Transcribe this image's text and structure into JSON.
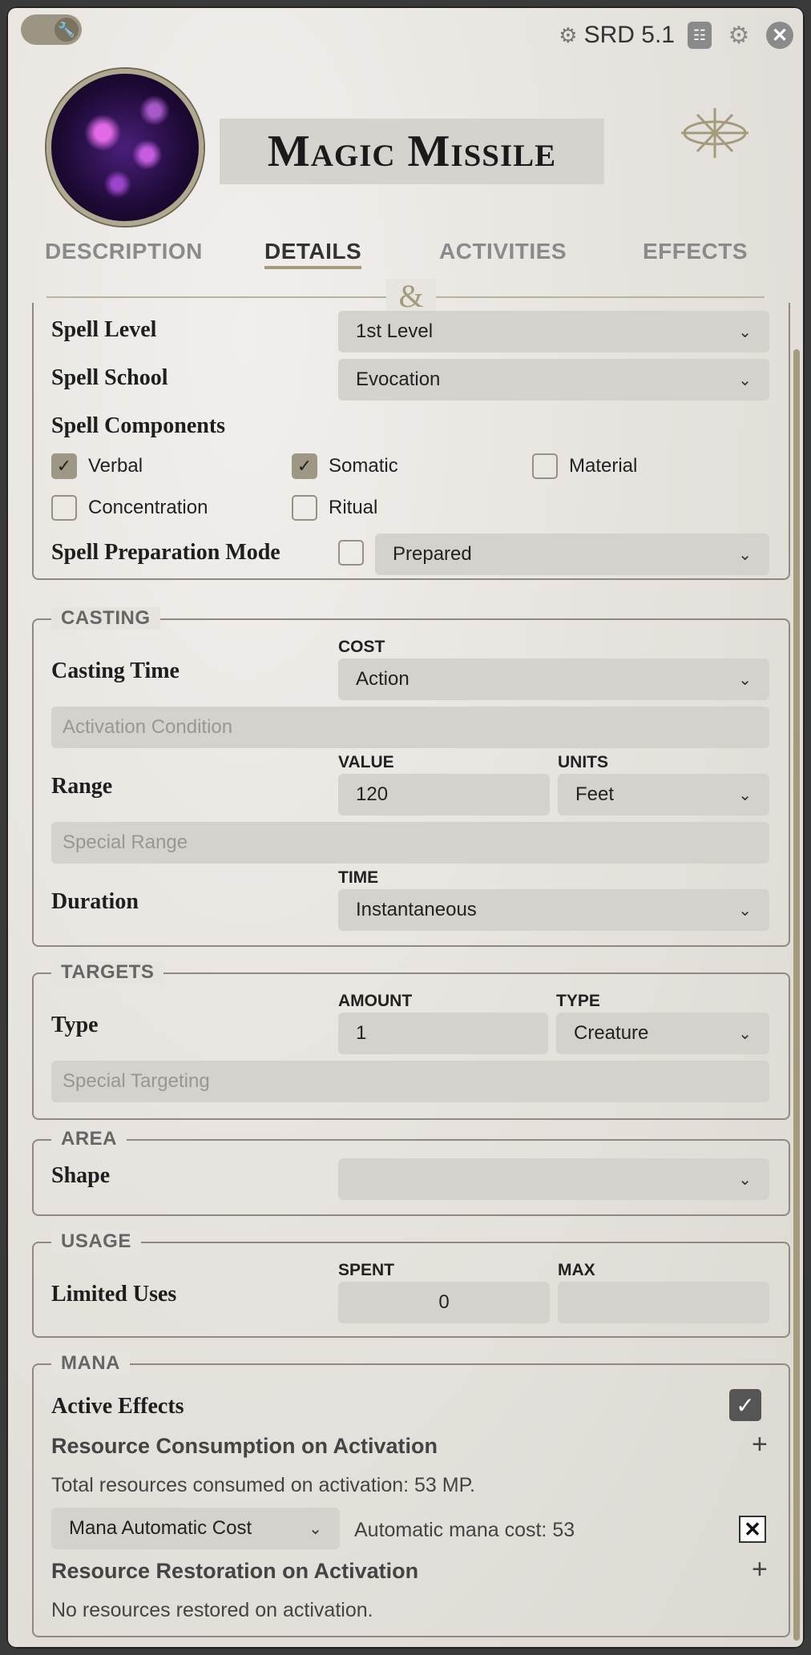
{
  "header": {
    "system_label": "SRD 5.1",
    "title": "Magic Missile",
    "icons": [
      "wrench-icon",
      "gear-icon",
      "journal-icon",
      "settings-icon",
      "close-icon",
      "emblem-icon"
    ]
  },
  "tabs": [
    {
      "label": "DESCRIPTION"
    },
    {
      "label": "DETAILS"
    },
    {
      "label": "ACTIVITIES"
    },
    {
      "label": "EFFECTS"
    }
  ],
  "divider_glyph": "&",
  "spell": {
    "level_label": "Spell Level",
    "level_value": "1st Level",
    "school_label": "Spell School",
    "school_value": "Evocation",
    "components_label": "Spell Components",
    "components": [
      {
        "label": "Verbal",
        "checked": true
      },
      {
        "label": "Somatic",
        "checked": true
      },
      {
        "label": "Material",
        "checked": false
      },
      {
        "label": "Concentration",
        "checked": false
      },
      {
        "label": "Ritual",
        "checked": false
      }
    ],
    "prep_label": "Spell Preparation Mode",
    "prep_value": "Prepared"
  },
  "casting": {
    "legend": "CASTING",
    "time_label": "Casting Time",
    "cost_label": "COST",
    "cost_value": "Action",
    "activation_placeholder": "Activation Condition",
    "range_label": "Range",
    "value_label": "VALUE",
    "value": "120",
    "units_label": "UNITS",
    "units_value": "Feet",
    "special_range_placeholder": "Special Range",
    "duration_label": "Duration",
    "time_sub_label": "TIME",
    "time_value": "Instantaneous"
  },
  "targets": {
    "legend": "TARGETS",
    "type_label": "Type",
    "amount_label": "AMOUNT",
    "amount_value": "1",
    "type_sub_label": "TYPE",
    "type_value": "Creature",
    "special_placeholder": "Special Targeting"
  },
  "area": {
    "legend": "AREA",
    "shape_label": "Shape",
    "shape_value": ""
  },
  "usage": {
    "legend": "USAGE",
    "limited_label": "Limited Uses",
    "spent_label": "SPENT",
    "spent_value": "0",
    "max_label": "MAX",
    "max_value": ""
  },
  "mana": {
    "legend": "MANA",
    "active_effects_label": "Active Effects",
    "active_effects_checked": true,
    "consumption_title": "Resource Consumption on Activation",
    "consumption_text": "Total resources consumed on activation: 53 MP.",
    "cost_select": "Mana Automatic Cost",
    "cost_text": "Automatic mana cost: 53",
    "restoration_title": "Resource Restoration on Activation",
    "restoration_text": "No resources restored on activation."
  }
}
